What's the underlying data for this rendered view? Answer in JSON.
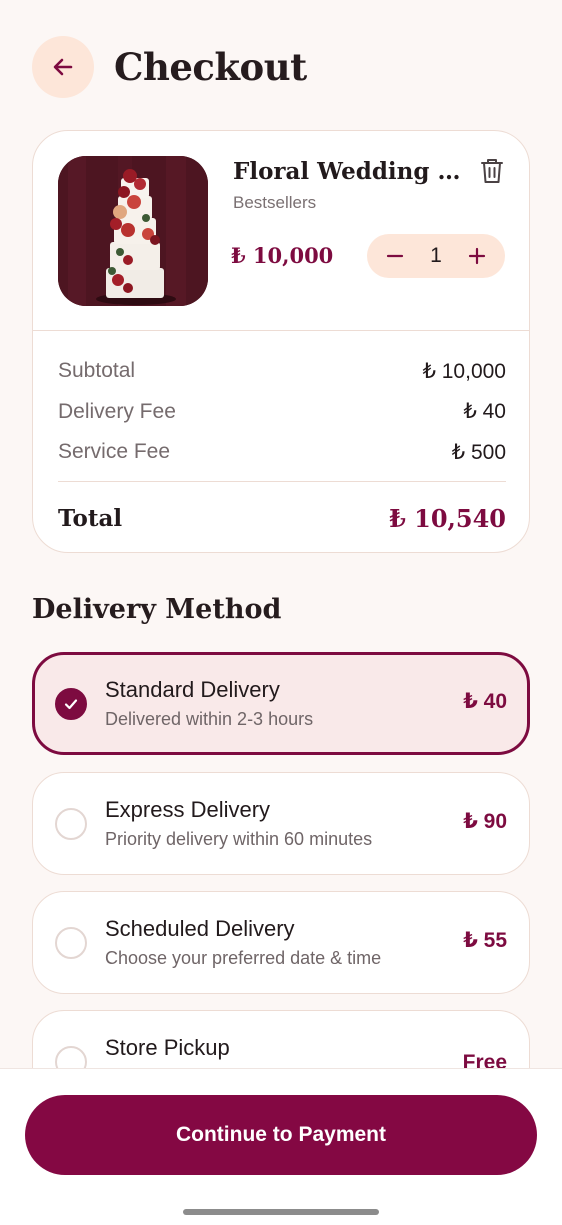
{
  "header": {
    "title": "Checkout",
    "back_icon": "arrow-left-icon"
  },
  "cart_item": {
    "name": "Floral Wedding Ca...",
    "category": "Bestsellers",
    "price": "₺ 10,000",
    "quantity": "1",
    "delete_icon": "trash-icon"
  },
  "summary": {
    "subtotal_label": "Subtotal",
    "subtotal_value": "₺ 10,000",
    "delivery_label": "Delivery Fee",
    "delivery_value": "₺ 40",
    "service_label": "Service Fee",
    "service_value": "₺ 500",
    "total_label": "Total",
    "total_value": "₺ 10,540"
  },
  "delivery": {
    "section_title": "Delivery Method",
    "options": [
      {
        "title": "Standard Delivery",
        "subtitle": "Delivered within 2-3 hours",
        "price": "₺ 40",
        "selected": true
      },
      {
        "title": "Express Delivery",
        "subtitle": "Priority delivery within 60 minutes",
        "price": "₺ 90",
        "selected": false
      },
      {
        "title": "Scheduled Delivery",
        "subtitle": "Choose your preferred date & time",
        "price": "₺ 55",
        "selected": false
      },
      {
        "title": "Store Pickup",
        "subtitle": "",
        "price": "Free",
        "selected": false
      }
    ]
  },
  "cta": {
    "label": "Continue to Payment"
  },
  "colors": {
    "accent": "#7d0b40",
    "cta": "#840843",
    "soft_peach": "#fde6d9",
    "background": "#fcf7f5"
  }
}
